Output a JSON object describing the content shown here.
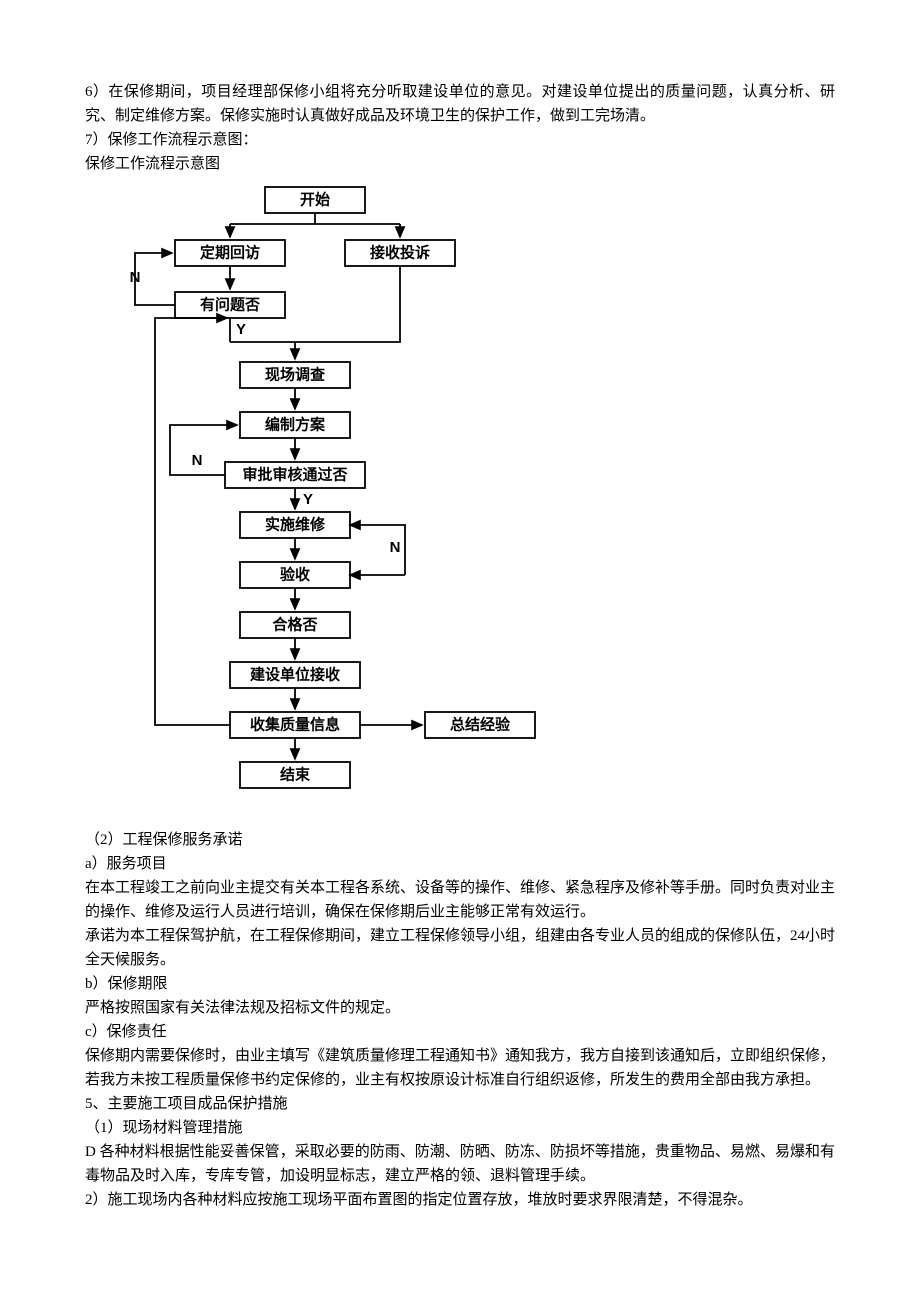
{
  "para1": "6）在保修期间，项目经理部保修小组将充分听取建设单位的意见。对建设单位提出的质量问题，认真分析、研究、制定维修方案。保修实施时认真做好成品及环境卫生的保护工作，做到工完场清。",
  "para2": "7）保修工作流程示意图：",
  "para3": "保修工作流程示意图",
  "flow": {
    "start": "开始",
    "visit": "定期回访",
    "complaint": "接收投诉",
    "hasIssue": "有问题否",
    "investigate": "现场调查",
    "plan": "编制方案",
    "approve": "审批审核通过否",
    "repair": "实施维修",
    "inspect": "验收",
    "qualified": "合格否",
    "handover": "建设单位接收",
    "collect": "收集质量信息",
    "summary": "总结经验",
    "end": "结束",
    "yes": "Y",
    "yes2": "Y",
    "no1": "N",
    "no2": "N",
    "no3": "N"
  },
  "s2_title": "（2）工程保修服务承诺",
  "s2_a_title": "a）服务项目",
  "s2_a_p1": "在本工程竣工之前向业主提交有关本工程各系统、设备等的操作、维修、紧急程序及修补等手册。同时负责对业主的操作、维修及运行人员进行培训，确保在保修期后业主能够正常有效运行。",
  "s2_a_p2": "承诺为本工程保驾护航，在工程保修期间，建立工程保修领导小组，组建由各专业人员的组成的保修队伍，24小时全天候服务。",
  "s2_b_title": "b）保修期限",
  "s2_b_p1": "严格按照国家有关法律法规及招标文件的规定。",
  "s2_c_title": "c）保修责任",
  "s2_c_p1": "保修期内需要保修时，由业主填写《建筑质量修理工程通知书》通知我方，我方自接到该通知后，立即组织保修，若我方未按工程质量保修书约定保修的，业主有权按原设计标准自行组织返修，所发生的费用全部由我方承担。",
  "s5_title": "5、主要施工项目成品保护措施",
  "s5_1_title": "（1）现场材料管理措施",
  "s5_1_p1": "D 各种材料根据性能妥善保管，采取必要的防雨、防潮、防晒、防冻、防损坏等措施，贵重物品、易燃、易爆和有毒物品及时入库，专库专管，加设明显标志，建立严格的领、退料管理手续。",
  "s5_1_p2": "2）施工现场内各种材料应按施工现场平面布置图的指定位置存放，堆放时要求界限清楚，不得混杂。"
}
